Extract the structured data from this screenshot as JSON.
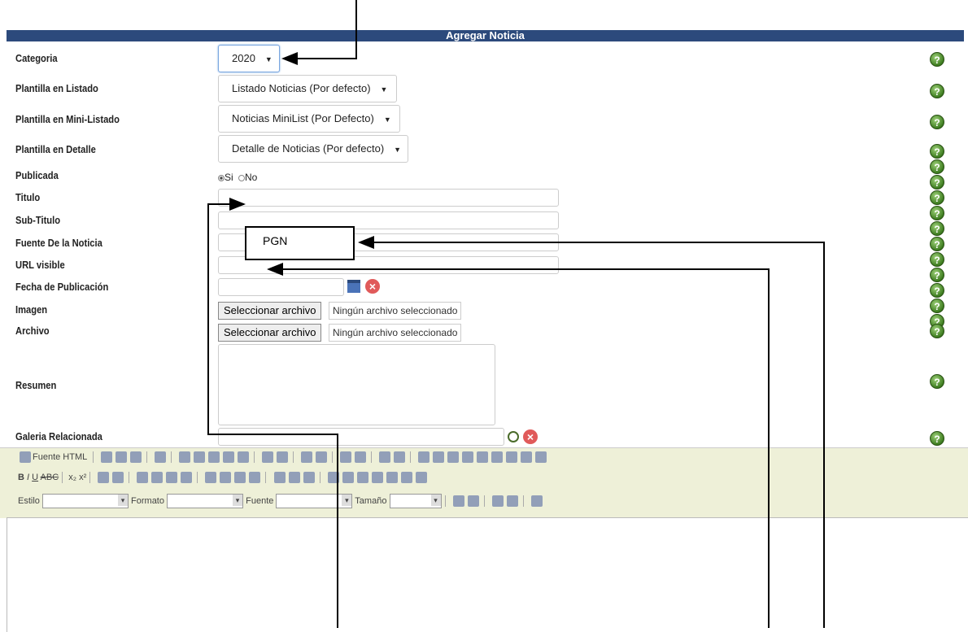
{
  "header": {
    "title": "Agregar Noticia"
  },
  "fields": {
    "categoria": {
      "label": "Categoria",
      "value": "2020"
    },
    "plantilla_listado": {
      "label": "Plantilla en Listado",
      "value": "Listado Noticias (Por defecto)"
    },
    "plantilla_mini": {
      "label": "Plantilla en Mini-Listado",
      "value": "Noticias MiniList (Por Defecto)"
    },
    "plantilla_detalle": {
      "label": "Plantilla en Detalle",
      "value": "Detalle de Noticias (Por defecto)"
    },
    "publicada": {
      "label": "Publicada",
      "opt_si": "Si",
      "opt_no": "No",
      "selected": "Si"
    },
    "titulo": {
      "label": "Titulo"
    },
    "subtitulo": {
      "label": "Sub-Titulo"
    },
    "fuente": {
      "label": "Fuente De la Noticia"
    },
    "url": {
      "label": "URL visible"
    },
    "fecha": {
      "label": "Fecha de Publicación"
    },
    "imagen": {
      "label": "Imagen",
      "button": "Seleccionar archivo",
      "status": "Ningún archivo seleccionado"
    },
    "archivo": {
      "label": "Archivo",
      "button": "Seleccionar archivo",
      "status": "Ningún archivo seleccionado"
    },
    "resumen": {
      "label": "Resumen"
    },
    "galeria": {
      "label": "Galeria Relacionada"
    }
  },
  "toolbar": {
    "source_label": "Fuente HTML",
    "estilo": "Estilo",
    "formato": "Formato",
    "fuente": "Fuente",
    "tamano": "Tamaño"
  },
  "annotation": {
    "callout_text": "PGN"
  },
  "colors": {
    "header_bg": "#2c4a7c",
    "editor_toolbar_bg": "#eef0d8",
    "help_icon": "#3d7c1f"
  }
}
